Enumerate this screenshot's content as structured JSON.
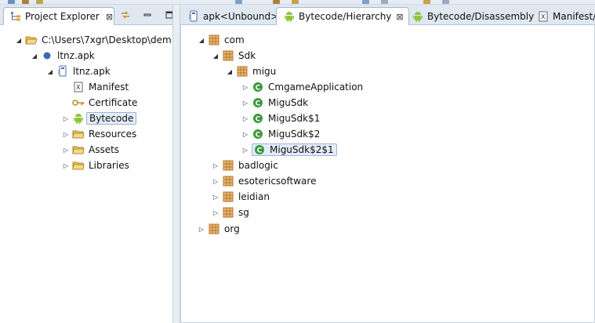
{
  "left_panel": {
    "tab_label": "Project Explorer",
    "tree": [
      {
        "label": "C:\\Users\\7xgr\\Desktop\\dem",
        "icon": "folder-open-icon",
        "expanded": true
      },
      {
        "label": "ltnz.apk",
        "icon": "apk-project-icon",
        "expanded": true
      },
      {
        "label": "ltnz.apk",
        "icon": "apk-artifact-icon",
        "expanded": true
      },
      {
        "label": "Manifest",
        "icon": "xml-file-icon",
        "expanded": null
      },
      {
        "label": "Certificate",
        "icon": "key-icon",
        "expanded": null
      },
      {
        "label": "Bytecode",
        "icon": "android-icon",
        "expanded": false,
        "selected": true
      },
      {
        "label": "Resources",
        "icon": "folder-icon",
        "expanded": false
      },
      {
        "label": "Assets",
        "icon": "folder-icon",
        "expanded": false
      },
      {
        "label": "Libraries",
        "icon": "folder-icon",
        "expanded": false
      }
    ]
  },
  "editor_tabs": [
    {
      "label": "apk<Unbound>",
      "icon": "apk-artifact-icon",
      "active": false
    },
    {
      "label": "Bytecode/Hierarchy",
      "icon": "android-icon",
      "active": true
    },
    {
      "label": "Bytecode/Disassembly",
      "icon": "android-icon",
      "active": false
    },
    {
      "label": "Manifest/F",
      "icon": "xml-file-icon",
      "active": false
    }
  ],
  "hierarchy_tree": [
    {
      "label": "com",
      "icon": "package-icon",
      "expanded": true
    },
    {
      "label": "Sdk",
      "icon": "package-icon",
      "expanded": true
    },
    {
      "label": "migu",
      "icon": "package-icon",
      "expanded": true
    },
    {
      "label": "CmgameApplication",
      "icon": "class-icon",
      "expanded": false
    },
    {
      "label": "MiguSdk",
      "icon": "class-icon",
      "expanded": false
    },
    {
      "label": "MiguSdk$1",
      "icon": "class-icon",
      "expanded": false
    },
    {
      "label": "MiguSdk$2",
      "icon": "class-icon",
      "expanded": false
    },
    {
      "label": "MiguSdk$2$1",
      "icon": "class-icon",
      "expanded": false,
      "selected": true
    },
    {
      "label": "badlogic",
      "icon": "package-icon",
      "expanded": false
    },
    {
      "label": "esotericsoftware",
      "icon": "package-icon",
      "expanded": false
    },
    {
      "label": "leidian",
      "icon": "package-icon",
      "expanded": false
    },
    {
      "label": "sg",
      "icon": "package-icon",
      "expanded": false
    },
    {
      "label": "org",
      "icon": "package-icon",
      "expanded": false
    }
  ],
  "colors": {
    "class_green": "#3a9a3a",
    "package_brown": "#b9772b",
    "android_green": "#8fc43c",
    "folder_yellow": "#e8c35a",
    "selection_bg": "#e3ecf8",
    "selection_border": "#9ab4d8"
  }
}
